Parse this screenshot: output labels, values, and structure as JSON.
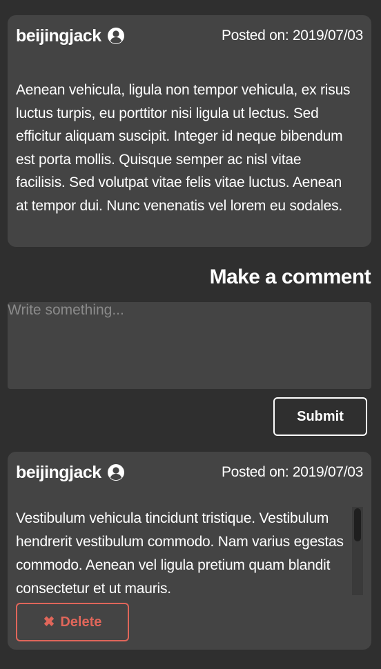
{
  "post": {
    "author": "beijingjack",
    "posted_on": "Posted on: 2019/07/03",
    "body": "Aenean vehicula, ligula non tempor vehicula, ex risus luctus turpis, eu porttitor nisi ligula ut lectus. Sed efficitur aliquam suscipit. Integer id neque bibendum est porta mollis. Quisque semper ac nisl vitae facilisis. Sed volutpat vitae felis vitae luctus. Aenean at tempor dui. Nunc venenatis vel lorem eu sodales."
  },
  "comment_form": {
    "heading": "Make a comment",
    "placeholder": "Write something...",
    "value": "",
    "submit_label": "Submit"
  },
  "comments": [
    {
      "author": "beijingjack",
      "posted_on": "Posted on: 2019/07/03",
      "body": "Vestibulum vehicula tincidunt tristique. Vestibulum hendrerit vestibulum commodo. Nam varius egestas commodo. Aenean vel ligula pretium quam blandit consectetur et ut mauris.",
      "delete_label": "Delete",
      "delete_icon": "x-icon"
    }
  ],
  "icons": {
    "user": "user-circle-icon",
    "delete": "x-icon"
  },
  "colors": {
    "background": "#2f2f2f",
    "card": "#444444",
    "text": "#ffffff",
    "placeholder": "#8a8a8a",
    "danger": "#e0665a"
  }
}
